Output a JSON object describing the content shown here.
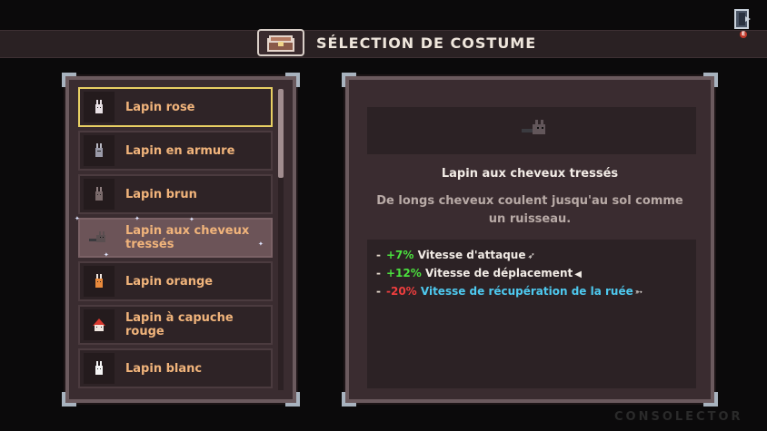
{
  "header": {
    "title": "SÉLECTION DE COSTUME",
    "exit_key": "E"
  },
  "costume_list": [
    {
      "label": "Lapin rose",
      "state": "selected",
      "icon": "pink-bunny-icon"
    },
    {
      "label": "Lapin en armure",
      "state": "normal",
      "icon": "armored-bunny-icon"
    },
    {
      "label": "Lapin brun",
      "state": "normal",
      "icon": "brown-bunny-icon"
    },
    {
      "label": "Lapin aux cheveux tressés",
      "state": "highlighted",
      "icon": "braided-bunny-icon"
    },
    {
      "label": "Lapin orange",
      "state": "normal",
      "icon": "orange-bunny-icon"
    },
    {
      "label": "Lapin à capuche rouge",
      "state": "normal",
      "icon": "red-hood-bunny-icon"
    },
    {
      "label": "Lapin blanc",
      "state": "normal",
      "icon": "white-bunny-icon"
    }
  ],
  "detail": {
    "name": "Lapin aux cheveux tressés",
    "description": "De longs cheveux coulent jusqu'au sol comme un ruisseau.",
    "stats": [
      {
        "value": "+7%",
        "label": "Vitesse d'attaque",
        "sign": "positive"
      },
      {
        "value": "+12%",
        "label": "Vitesse de déplacement",
        "sign": "positive"
      },
      {
        "value": "-20%",
        "label": "Vitesse de récupération de la ruée",
        "sign": "negative"
      }
    ]
  },
  "watermark": "CONSOLECTOR",
  "colors": {
    "accent_selected": "#e8cf63",
    "label": "#f1b47b",
    "positive": "#4be03e",
    "negative": "#ef3e3e",
    "dash_stat": "#4ec9ef"
  }
}
